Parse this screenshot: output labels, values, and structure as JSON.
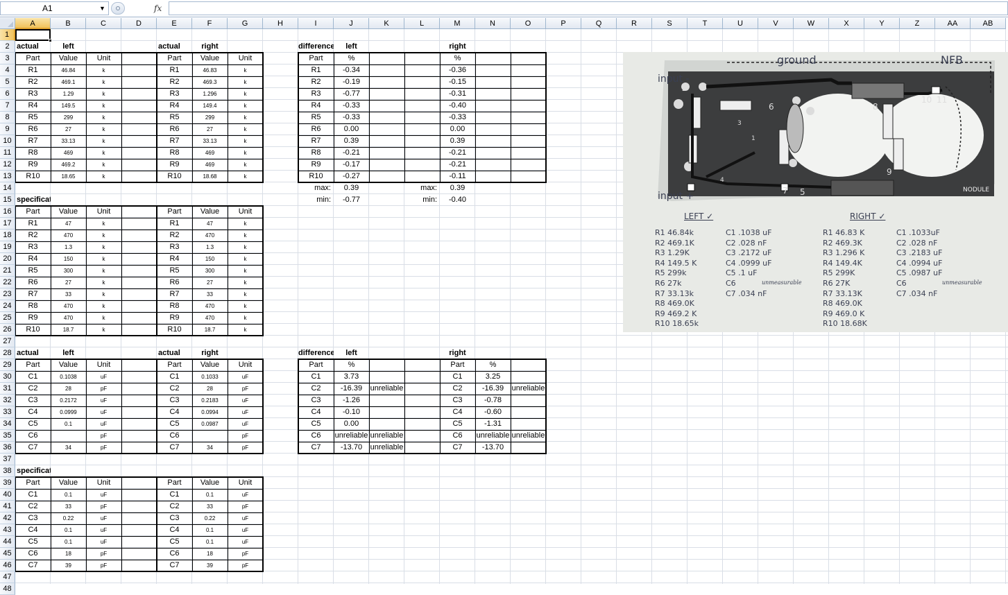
{
  "formula_bar": {
    "name_box": "A1",
    "fx_label": "fx",
    "formula": ""
  },
  "columns": [
    "A",
    "B",
    "C",
    "D",
    "E",
    "F",
    "G",
    "H",
    "I",
    "J",
    "K",
    "L",
    "M",
    "N",
    "O",
    "P",
    "Q",
    "R",
    "S",
    "T",
    "U",
    "V",
    "W",
    "X",
    "Y",
    "Z",
    "AA",
    "AB"
  ],
  "rows": [
    "1",
    "2",
    "3",
    "4",
    "5",
    "6",
    "7",
    "8",
    "9",
    "10",
    "11",
    "12",
    "13",
    "14",
    "15",
    "16",
    "17",
    "18",
    "19",
    "20",
    "21",
    "22",
    "23",
    "24",
    "25",
    "26",
    "27",
    "28",
    "29",
    "30",
    "31",
    "32",
    "33",
    "34",
    "35",
    "36",
    "37",
    "38",
    "39",
    "40",
    "41",
    "42",
    "43",
    "44",
    "45",
    "46",
    "47",
    "48"
  ],
  "selected_cell": "A1",
  "tables": {
    "res_actual": {
      "labels_left": [
        "actual",
        "left"
      ],
      "labels_right": [
        "actual",
        "right"
      ],
      "header": [
        "Part",
        "Value",
        "Unit"
      ],
      "left": [
        [
          "R1",
          "46.84",
          "k"
        ],
        [
          "R2",
          "469.1",
          "k"
        ],
        [
          "R3",
          "1.29",
          "k"
        ],
        [
          "R4",
          "149.5",
          "k"
        ],
        [
          "R5",
          "299",
          "k"
        ],
        [
          "R6",
          "27",
          "k"
        ],
        [
          "R7",
          "33.13",
          "k"
        ],
        [
          "R8",
          "469",
          "k"
        ],
        [
          "R9",
          "469.2",
          "k"
        ],
        [
          "R10",
          "18.65",
          "k"
        ]
      ],
      "right": [
        [
          "R1",
          "46.83",
          "k"
        ],
        [
          "R2",
          "469.3",
          "k"
        ],
        [
          "R3",
          "1.296",
          "k"
        ],
        [
          "R4",
          "149.4",
          "k"
        ],
        [
          "R5",
          "299",
          "k"
        ],
        [
          "R6",
          "27",
          "k"
        ],
        [
          "R7",
          "33.13",
          "k"
        ],
        [
          "R8",
          "469",
          "k"
        ],
        [
          "R9",
          "469",
          "k"
        ],
        [
          "R10",
          "18.68",
          "k"
        ]
      ]
    },
    "res_spec": {
      "label": "specification",
      "header": [
        "Part",
        "Value",
        "Unit"
      ],
      "left": [
        [
          "R1",
          "47",
          "k"
        ],
        [
          "R2",
          "470",
          "k"
        ],
        [
          "R3",
          "1.3",
          "k"
        ],
        [
          "R4",
          "150",
          "k"
        ],
        [
          "R5",
          "300",
          "k"
        ],
        [
          "R6",
          "27",
          "k"
        ],
        [
          "R7",
          "33",
          "k"
        ],
        [
          "R8",
          "470",
          "k"
        ],
        [
          "R9",
          "470",
          "k"
        ],
        [
          "R10",
          "18.7",
          "k"
        ]
      ],
      "right": [
        [
          "R1",
          "47",
          "k"
        ],
        [
          "R2",
          "470",
          "k"
        ],
        [
          "R3",
          "1.3",
          "k"
        ],
        [
          "R4",
          "150",
          "k"
        ],
        [
          "R5",
          "300",
          "k"
        ],
        [
          "R6",
          "27",
          "k"
        ],
        [
          "R7",
          "33",
          "k"
        ],
        [
          "R8",
          "470",
          "k"
        ],
        [
          "R9",
          "470",
          "k"
        ],
        [
          "R10",
          "18.7",
          "k"
        ]
      ]
    },
    "res_diff": {
      "labels": [
        "difference",
        "left",
        "right"
      ],
      "header": [
        "Part",
        "%",
        "%"
      ],
      "rows": [
        [
          "R1",
          "-0.34",
          "-0.36"
        ],
        [
          "R2",
          "-0.19",
          "-0.15"
        ],
        [
          "R3",
          "-0.77",
          "-0.31"
        ],
        [
          "R4",
          "-0.33",
          "-0.40"
        ],
        [
          "R5",
          "-0.33",
          "-0.33"
        ],
        [
          "R6",
          "0.00",
          "0.00"
        ],
        [
          "R7",
          "0.39",
          "0.39"
        ],
        [
          "R8",
          "-0.21",
          "-0.21"
        ],
        [
          "R9",
          "-0.17",
          "-0.21"
        ],
        [
          "R10",
          "-0.27",
          "-0.11"
        ]
      ],
      "max_label": "max:",
      "min_label": "min:",
      "left_max": "0.39",
      "left_min": "-0.77",
      "right_max": "0.39",
      "right_min": "-0.40"
    },
    "cap_actual": {
      "labels_left": [
        "actual",
        "left"
      ],
      "labels_right": [
        "actual",
        "right"
      ],
      "header": [
        "Part",
        "Value",
        "Unit"
      ],
      "left": [
        [
          "C1",
          "0.1038",
          "uF"
        ],
        [
          "C2",
          "28",
          "pF"
        ],
        [
          "C3",
          "0.2172",
          "uF"
        ],
        [
          "C4",
          "0.0999",
          "uF"
        ],
        [
          "C5",
          "0.1",
          "uF"
        ],
        [
          "C6",
          "",
          "pF"
        ],
        [
          "C7",
          "34",
          "pF"
        ]
      ],
      "right": [
        [
          "C1",
          "0.1033",
          "uF"
        ],
        [
          "C2",
          "28",
          "pF"
        ],
        [
          "C3",
          "0.2183",
          "uF"
        ],
        [
          "C4",
          "0.0994",
          "uF"
        ],
        [
          "C5",
          "0.0987",
          "uF"
        ],
        [
          "C6",
          "",
          "pF"
        ],
        [
          "C7",
          "34",
          "pF"
        ]
      ]
    },
    "cap_diff": {
      "labels": [
        "difference",
        "left",
        "right"
      ],
      "header": [
        "Part",
        "%"
      ],
      "left": [
        [
          "C1",
          "3.73",
          ""
        ],
        [
          "C2",
          "-16.39",
          "unreliable"
        ],
        [
          "C3",
          "-1.26",
          ""
        ],
        [
          "C4",
          "-0.10",
          ""
        ],
        [
          "C5",
          "0.00",
          ""
        ],
        [
          "C6",
          "unreliable",
          "unreliable"
        ],
        [
          "C7",
          "-13.70",
          "unreliable"
        ]
      ],
      "right": [
        [
          "C1",
          "3.25",
          ""
        ],
        [
          "C2",
          "-16.39",
          "unreliable"
        ],
        [
          "C3",
          "-0.78",
          ""
        ],
        [
          "C4",
          "-0.60",
          ""
        ],
        [
          "C5",
          "-1.31",
          ""
        ],
        [
          "C6",
          "unreliable",
          "unreliable"
        ],
        [
          "C7",
          "-13.70",
          ""
        ]
      ]
    },
    "cap_spec": {
      "label": "specification",
      "header": [
        "Part",
        "Value",
        "Unit"
      ],
      "left": [
        [
          "C1",
          "0.1",
          "uF"
        ],
        [
          "C2",
          "33",
          "pF"
        ],
        [
          "C3",
          "0.22",
          "uF"
        ],
        [
          "C4",
          "0.1",
          "uF"
        ],
        [
          "C5",
          "0.1",
          "uF"
        ],
        [
          "C6",
          "18",
          "pF"
        ],
        [
          "C7",
          "39",
          "pF"
        ]
      ],
      "right": [
        [
          "C1",
          "0.1",
          "uF"
        ],
        [
          "C2",
          "33",
          "pF"
        ],
        [
          "C3",
          "0.22",
          "uF"
        ],
        [
          "C4",
          "0.1",
          "uF"
        ],
        [
          "C5",
          "0.1",
          "uF"
        ],
        [
          "C6",
          "18",
          "pF"
        ],
        [
          "C7",
          "39",
          "pF"
        ]
      ]
    }
  },
  "photo": {
    "board_labels": [
      "ground",
      "NFB",
      "input -",
      "input +",
      "NODULE"
    ],
    "pad_numbers": [
      "2",
      "6",
      "8",
      "3",
      "1",
      "10",
      "11",
      "7",
      "4",
      "5",
      "9"
    ],
    "left_heading": "LEFT ✓",
    "right_heading": "RIGHT ✓",
    "left_r": [
      "R1 46.84k",
      "R2 469.1K",
      "R3 1.29K",
      "R4 149.5 K",
      "R5 299k",
      "R6 27k",
      "R7 33.13k",
      "R8 469.0K",
      "R9 469.2 K",
      "R10 18.65k"
    ],
    "left_c": [
      "C1 .1038 uF",
      "C2 .028 nF",
      "C3 .2172 uF",
      "C4 .0999 uF",
      "C5 .1 uF",
      "C6",
      "C7 .034 nF"
    ],
    "right_r": [
      "R1 46.83 K",
      "R2 469.3K",
      "R3 1.296 K",
      "R4 149.4K",
      "R5 299K",
      "R6 27K",
      "R7 33.13K",
      "R8 469.0K",
      "R9 469.0 K",
      "R10 18.68K"
    ],
    "right_c": [
      "C1 .1033uF",
      "C2 .028 nF",
      "C3 .2183 uF",
      "C4 .0994 uF",
      "C5 .0987 uF",
      "C6",
      "C7 .034 nF"
    ],
    "note": "unmeasurable"
  }
}
